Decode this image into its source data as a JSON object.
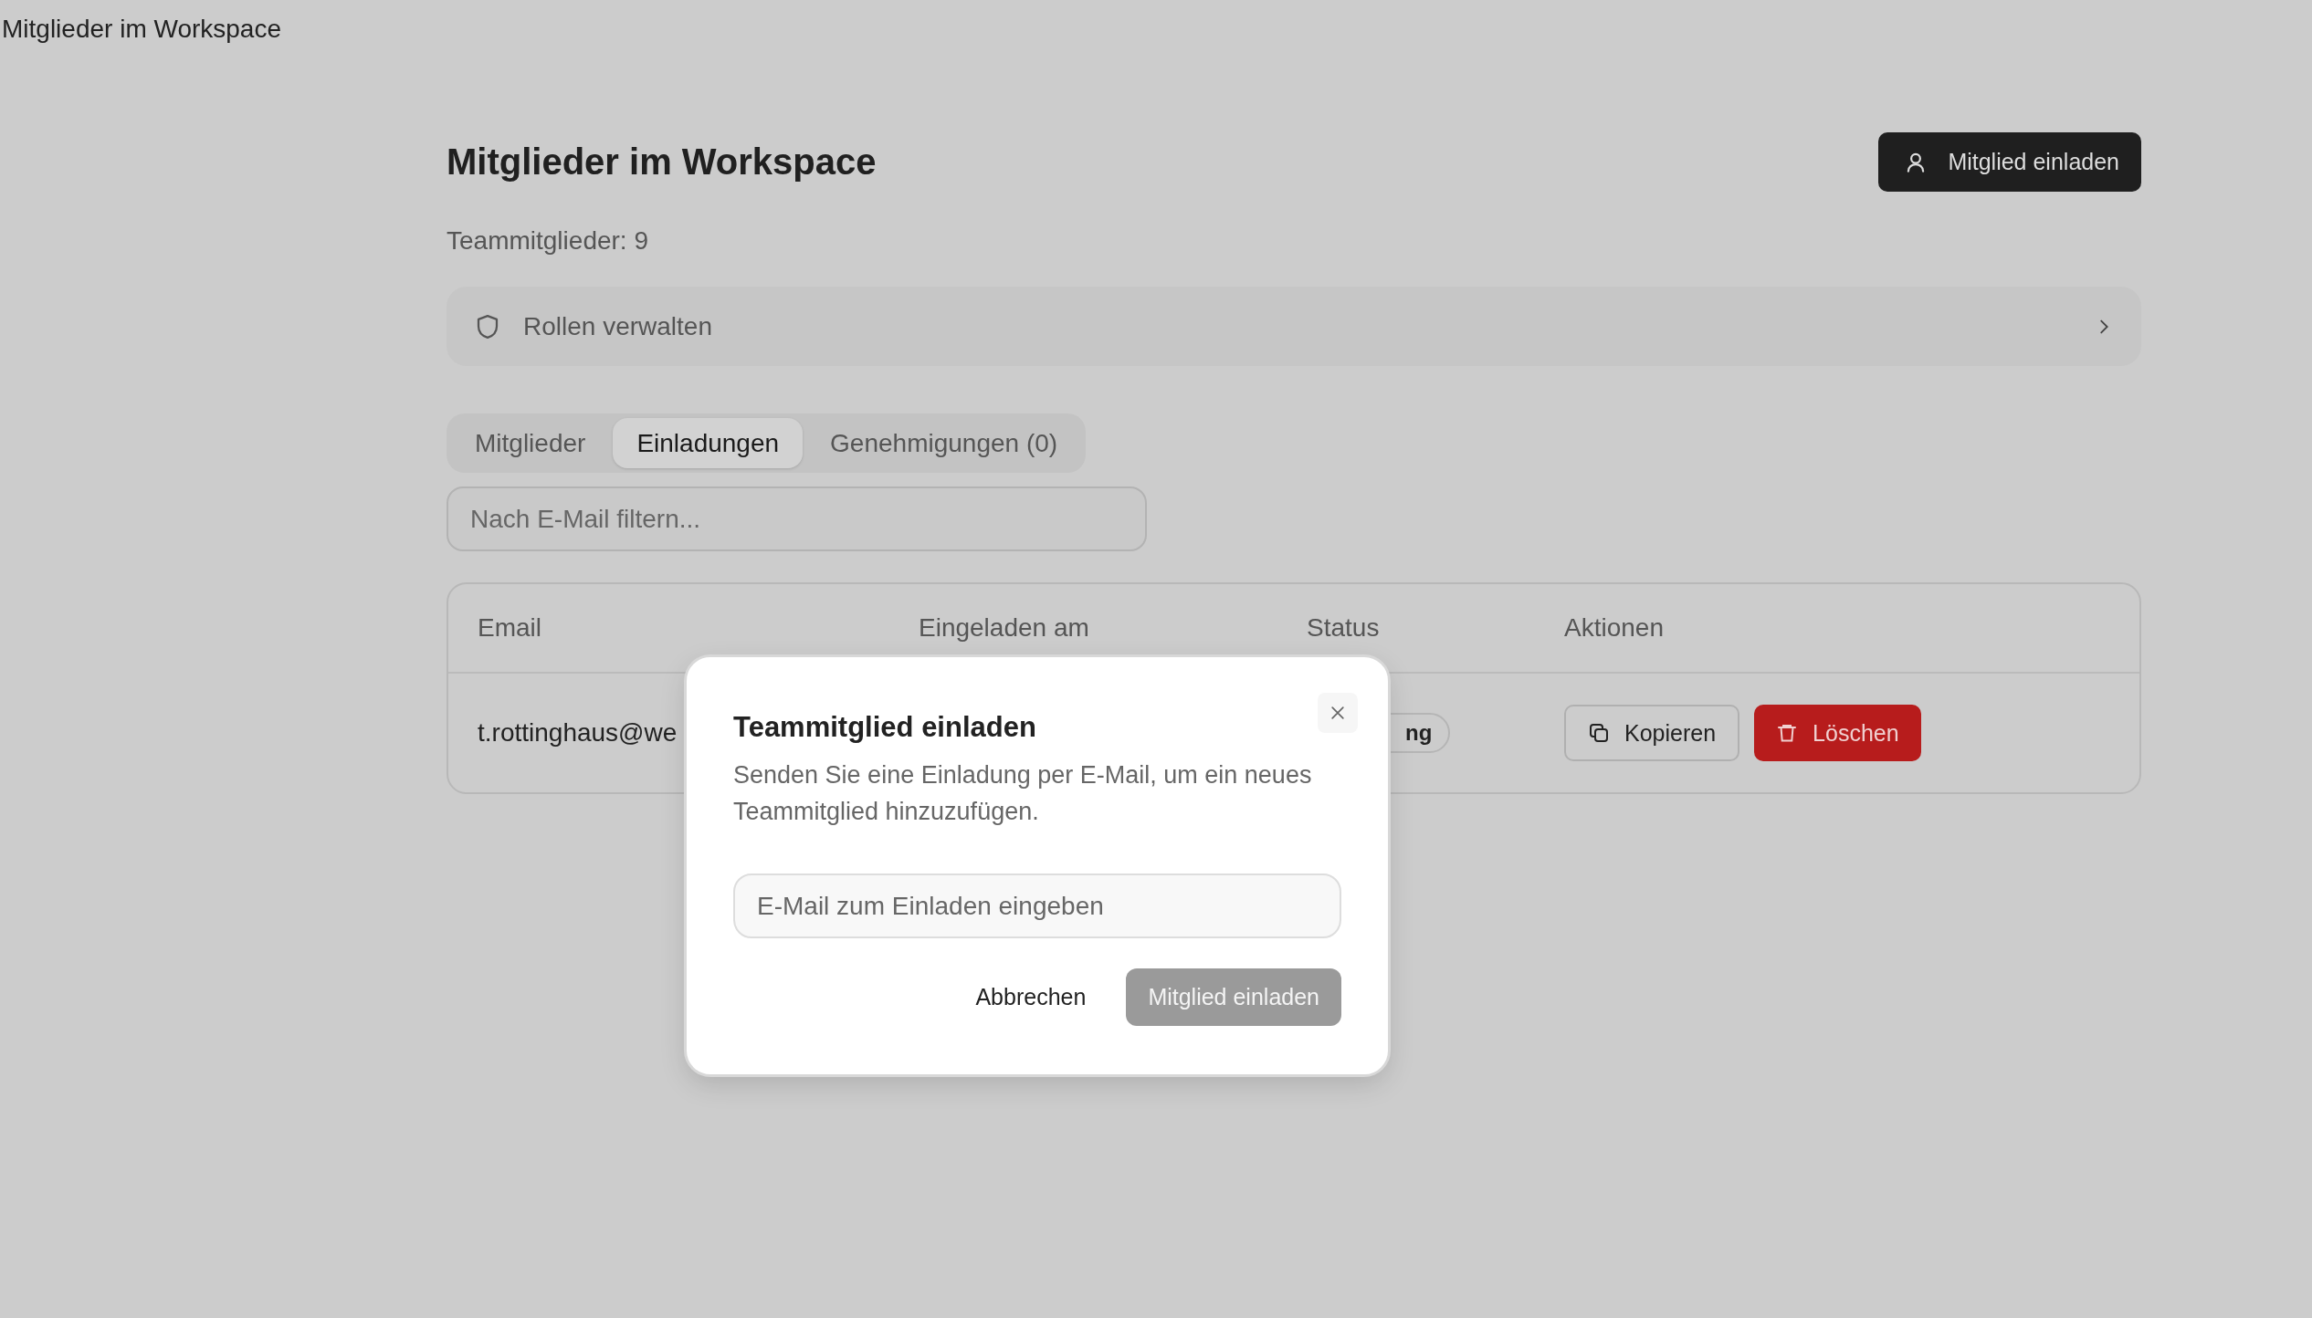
{
  "page_title": "Mitglieder im Workspace",
  "header": {
    "title": "Mitglieder im Workspace",
    "invite_button": "Mitglied einladen"
  },
  "member_count": "Teammitglieder: 9",
  "roles_link": "Rollen verwalten",
  "tabs": [
    {
      "label": "Mitglieder",
      "selected": false
    },
    {
      "label": "Einladungen",
      "selected": true
    },
    {
      "label": "Genehmigungen (0)",
      "selected": false
    }
  ],
  "filter": {
    "placeholder": "Nach E-Mail filtern..."
  },
  "table": {
    "columns": [
      "Email",
      "Eingeladen am",
      "Status",
      "Aktionen"
    ],
    "rows": [
      {
        "email": "t.rottinghaus@we",
        "status": "ng",
        "actions": [
          {
            "kind": "copy",
            "label": "Kopieren"
          },
          {
            "kind": "delete",
            "label": "Löschen"
          }
        ]
      }
    ]
  },
  "dialog": {
    "title": "Teammitglied einladen",
    "description": "Senden Sie eine Einladung per E-Mail, um ein neues Teammitglied hinzuzufügen.",
    "email_field": {
      "placeholder": "E-Mail zum Einladen eingeben"
    },
    "cancel": "Abbrechen",
    "submit": {
      "label": "Mitglied einladen",
      "disabled": true
    }
  }
}
